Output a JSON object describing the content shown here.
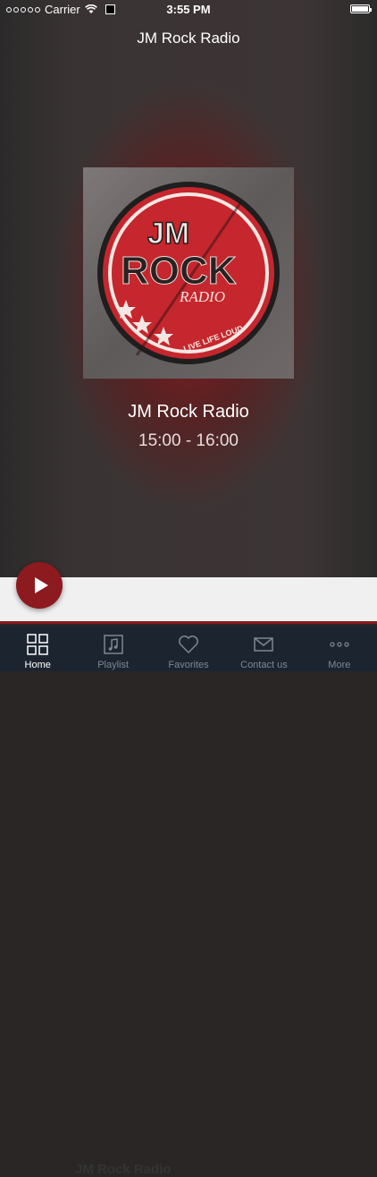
{
  "status_bar": {
    "carrier": "Carrier",
    "time": "3:55 PM"
  },
  "header": {
    "title": "JM Rock Radio"
  },
  "now_playing": {
    "logo_text": {
      "top": "JM",
      "main": "ROCK",
      "sub": "RADIO",
      "slogan": "LIVE LIFE LOUD"
    },
    "station_name": "JM Rock Radio",
    "time_range": "15:00 - 16:00"
  },
  "player": {
    "title": "JM Rock Radio"
  },
  "tabs": [
    {
      "label": "Home",
      "icon": "grid-icon",
      "active": true
    },
    {
      "label": "Playlist",
      "icon": "music-note-icon",
      "active": false
    },
    {
      "label": "Favorites",
      "icon": "heart-icon",
      "active": false
    },
    {
      "label": "Contact us",
      "icon": "envelope-icon",
      "active": false
    },
    {
      "label": "More",
      "icon": "more-dots-icon",
      "active": false
    }
  ],
  "colors": {
    "accent": "#8d1a1f",
    "tabbar": "#1c2430",
    "tab_inactive": "#7d8794"
  }
}
